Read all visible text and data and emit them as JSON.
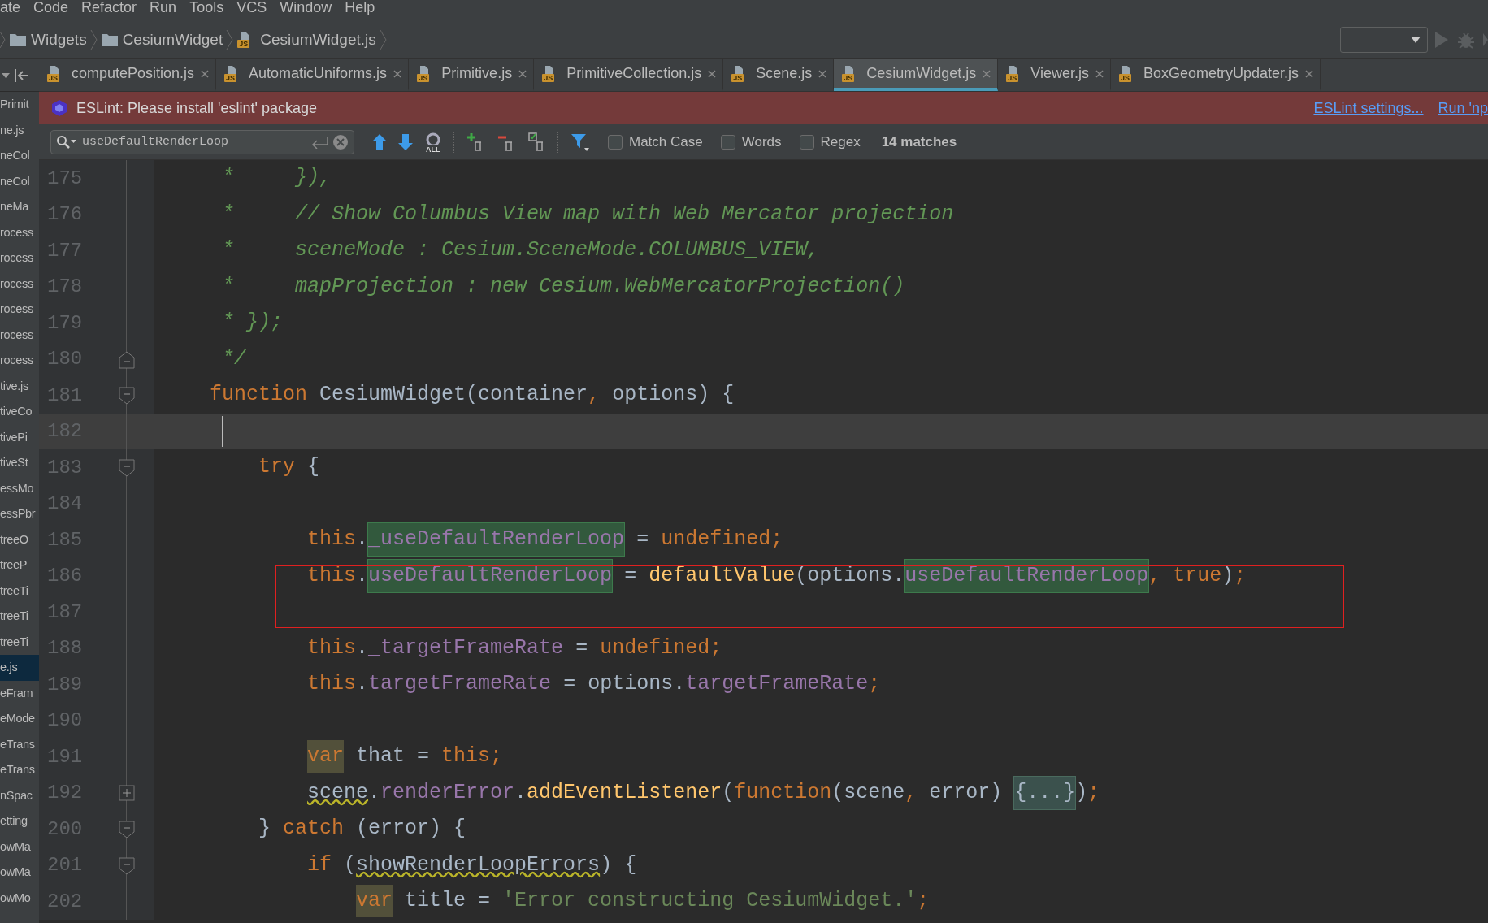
{
  "menu": [
    "ate",
    "Code",
    "Refactor",
    "Run",
    "Tools",
    "VCS",
    "Window",
    "Help"
  ],
  "breadcrumbs": [
    {
      "kind": "folder",
      "label": "Widgets"
    },
    {
      "kind": "folder",
      "label": "CesiumWidget"
    },
    {
      "kind": "js",
      "label": "CesiumWidget.js",
      "icon_label": "JS"
    }
  ],
  "project_tree": [
    {
      "label": "Primit",
      "selected": false
    },
    {
      "label": "ne.js",
      "selected": false
    },
    {
      "label": "neCol",
      "selected": false
    },
    {
      "label": "neCol",
      "selected": false
    },
    {
      "label": "neMa",
      "selected": false
    },
    {
      "label": "rocess",
      "selected": false
    },
    {
      "label": "rocess",
      "selected": false
    },
    {
      "label": "rocess",
      "selected": false
    },
    {
      "label": "rocess",
      "selected": false
    },
    {
      "label": "rocess",
      "selected": false
    },
    {
      "label": "rocess",
      "selected": false
    },
    {
      "label": "tive.js",
      "selected": false
    },
    {
      "label": "tiveCo",
      "selected": false
    },
    {
      "label": "tivePi",
      "selected": false
    },
    {
      "label": "tiveSt",
      "selected": false
    },
    {
      "label": "essMo",
      "selected": false
    },
    {
      "label": "essPbr",
      "selected": false
    },
    {
      "label": "treeO",
      "selected": false
    },
    {
      "label": "treeP",
      "selected": false
    },
    {
      "label": "treeTi",
      "selected": false
    },
    {
      "label": "treeTi",
      "selected": false
    },
    {
      "label": "treeTi",
      "selected": false
    },
    {
      "label": "e.js",
      "selected": true
    },
    {
      "label": "eFram",
      "selected": false
    },
    {
      "label": "eMode",
      "selected": false
    },
    {
      "label": "eTrans",
      "selected": false
    },
    {
      "label": "eTrans",
      "selected": false
    },
    {
      "label": "nSpac",
      "selected": false
    },
    {
      "label": "etting",
      "selected": false
    },
    {
      "label": "owMa",
      "selected": false
    },
    {
      "label": "owMa",
      "selected": false
    },
    {
      "label": "owMo",
      "selected": false
    }
  ],
  "tabs": [
    {
      "label": "computePosition.js",
      "icon_label": "JS",
      "selected": false
    },
    {
      "label": "AutomaticUniforms.js",
      "icon_label": "JS",
      "selected": false
    },
    {
      "label": "Primitive.js",
      "icon_label": "JS",
      "selected": false
    },
    {
      "label": "PrimitiveCollection.js",
      "icon_label": "JS",
      "selected": false
    },
    {
      "label": "Scene.js",
      "icon_label": "JS",
      "selected": false
    },
    {
      "label": "CesiumWidget.js",
      "icon_label": "JS",
      "selected": true
    },
    {
      "label": "Viewer.js",
      "icon_label": "JS",
      "selected": false
    },
    {
      "label": "BoxGeometryUpdater.js",
      "icon_label": "JS",
      "selected": false
    }
  ],
  "notification": {
    "message": "ESLint: Please install 'eslint' package",
    "links": [
      "ESLint settings...",
      "Run 'np"
    ]
  },
  "search": {
    "value": "useDefaultRenderLoop",
    "find_all_label": "ALL",
    "options": [
      {
        "label": "Match Case",
        "checked": false
      },
      {
        "label": "Words",
        "checked": false
      },
      {
        "label": "Regex",
        "checked": false
      }
    ],
    "matches": "14 matches"
  },
  "lines": [
    {
      "number": "175",
      "current": false,
      "kind": "code",
      "tokens": [
        {
          "text": " *     }),",
          "kind": "comment"
        }
      ]
    },
    {
      "number": "176",
      "current": false,
      "kind": "code",
      "tokens": [
        {
          "text": " *     // Show Columbus View map with Web Mercator projection",
          "kind": "comment"
        }
      ]
    },
    {
      "number": "177",
      "current": false,
      "kind": "code",
      "tokens": [
        {
          "text": " *     sceneMode : Cesium.SceneMode.COLUMBUS_VIEW,",
          "kind": "comment"
        }
      ]
    },
    {
      "number": "178",
      "current": false,
      "kind": "code",
      "tokens": [
        {
          "text": " *     mapProjection : new Cesium.WebMercatorProjection()",
          "kind": "comment"
        }
      ]
    },
    {
      "number": "179",
      "current": false,
      "kind": "code",
      "tokens": [
        {
          "text": " * });",
          "kind": "comment"
        }
      ]
    },
    {
      "number": "180",
      "current": false,
      "kind": "fold-end",
      "tokens": [
        {
          "text": " */",
          "kind": "comment"
        }
      ]
    },
    {
      "number": "181",
      "current": false,
      "kind": "fold-start",
      "tokens": [
        {
          "text": "function",
          "kind": "keyword"
        },
        {
          "text": " CesiumWidget(container",
          "kind": "plain"
        },
        {
          "text": ",",
          "kind": "sep"
        },
        {
          "text": " options) {",
          "kind": "plain"
        }
      ]
    },
    {
      "number": "182",
      "current": true,
      "kind": "code"
    },
    {
      "number": "183",
      "current": false,
      "kind": "fold-start",
      "tokens": [
        {
          "text": "    try",
          "kind": "keyword"
        },
        {
          "text": " {",
          "kind": "plain"
        }
      ]
    },
    {
      "number": "184",
      "current": false,
      "kind": "code"
    },
    {
      "number": "185",
      "current": false,
      "kind": "code",
      "tokens": [
        {
          "text": "        this",
          "kind": "keyword"
        },
        {
          "text": ".",
          "kind": "plain"
        },
        {
          "text": "_useDefaultRenderLoop",
          "kind": "field-match"
        },
        {
          "text": " = ",
          "kind": "plain"
        },
        {
          "text": "undefined",
          "kind": "keyword"
        },
        {
          "text": ";",
          "kind": "sep"
        }
      ]
    },
    {
      "number": "186",
      "current": false,
      "kind": "code",
      "tokens": [
        {
          "text": "        this",
          "kind": "keyword"
        },
        {
          "text": ".",
          "kind": "plain"
        },
        {
          "text": "useDefaultRenderLoop",
          "kind": "field-match"
        },
        {
          "text": " = ",
          "kind": "plain"
        },
        {
          "text": "defaultValue",
          "kind": "call"
        },
        {
          "text": "(options.",
          "kind": "plain"
        },
        {
          "text": "useDefaultRenderLoop",
          "kind": "field-match"
        },
        {
          "text": ", ",
          "kind": "sep"
        },
        {
          "text": "true",
          "kind": "keyword"
        },
        {
          "text": ")",
          "kind": "plain"
        },
        {
          "text": ";",
          "kind": "sep"
        }
      ]
    },
    {
      "number": "187",
      "current": false,
      "kind": "code"
    },
    {
      "number": "188",
      "current": false,
      "kind": "code",
      "tokens": [
        {
          "text": "        this",
          "kind": "keyword"
        },
        {
          "text": ".",
          "kind": "plain"
        },
        {
          "text": "_targetFrameRate",
          "kind": "field"
        },
        {
          "text": " = ",
          "kind": "plain"
        },
        {
          "text": "undefined",
          "kind": "keyword"
        },
        {
          "text": ";",
          "kind": "sep"
        }
      ]
    },
    {
      "number": "189",
      "current": false,
      "kind": "code",
      "tokens": [
        {
          "text": "        this",
          "kind": "keyword"
        },
        {
          "text": ".",
          "kind": "plain"
        },
        {
          "text": "targetFrameRate",
          "kind": "field"
        },
        {
          "text": " = options.",
          "kind": "plain"
        },
        {
          "text": "targetFrameRate",
          "kind": "field"
        },
        {
          "text": ";",
          "kind": "sep"
        }
      ]
    },
    {
      "number": "190",
      "current": false,
      "kind": "code"
    },
    {
      "number": "191",
      "current": false,
      "kind": "code",
      "tokens": [
        {
          "text": "        var",
          "kind": "keyword-usage"
        },
        {
          "text": " that = ",
          "kind": "plain"
        },
        {
          "text": "this",
          "kind": "keyword"
        },
        {
          "text": ";",
          "kind": "sep"
        }
      ]
    },
    {
      "number": "192",
      "current": false,
      "kind": "fold-collapsed",
      "tokens": [
        {
          "text": "        scene",
          "kind": "plain-warning"
        },
        {
          "text": ".",
          "kind": "plain"
        },
        {
          "text": "renderError",
          "kind": "field"
        },
        {
          "text": ".",
          "kind": "plain"
        },
        {
          "text": "addEventListener",
          "kind": "call"
        },
        {
          "text": "(",
          "kind": "plain"
        },
        {
          "text": "function",
          "kind": "keyword"
        },
        {
          "text": "(scene",
          "kind": "plain"
        },
        {
          "text": ", ",
          "kind": "sep"
        },
        {
          "text": "error) ",
          "kind": "plain"
        },
        {
          "text": "{...}",
          "kind": "plain-folded"
        },
        {
          "text": ")",
          "kind": "plain"
        },
        {
          "text": ";",
          "kind": "sep"
        }
      ]
    },
    {
      "number": "200",
      "current": false,
      "kind": "fold-start",
      "tokens": [
        {
          "text": "    } ",
          "kind": "plain"
        },
        {
          "text": "catch",
          "kind": "keyword"
        },
        {
          "text": " (error) {",
          "kind": "plain"
        }
      ]
    },
    {
      "number": "201",
      "current": false,
      "kind": "fold-start",
      "tokens": [
        {
          "text": "        if",
          "kind": "keyword"
        },
        {
          "text": " (",
          "kind": "plain"
        },
        {
          "text": "showRenderLoopErrors",
          "kind": "plain-warning"
        },
        {
          "text": ") {",
          "kind": "plain"
        }
      ]
    },
    {
      "number": "202",
      "current": false,
      "kind": "code",
      "tokens": [
        {
          "text": "            var",
          "kind": "keyword-usage"
        },
        {
          "text": " title = ",
          "kind": "plain"
        },
        {
          "text": "'Error constructing CesiumWidget.'",
          "kind": "string"
        },
        {
          "text": ";",
          "kind": "sep"
        }
      ]
    }
  ]
}
